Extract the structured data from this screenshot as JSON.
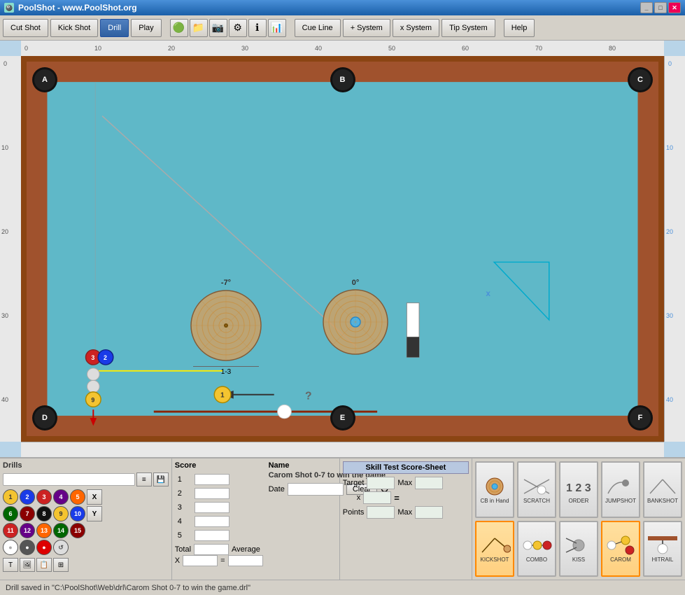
{
  "titlebar": {
    "title": "PoolShot - www.PoolShot.org",
    "icon": "🎱",
    "controls": [
      "_",
      "□",
      "✕"
    ]
  },
  "toolbar": {
    "cut_shot": "Cut Shot",
    "kick_shot": "Kick Shot",
    "drill": "Drill",
    "play": "Play",
    "cue_line": "Cue Line",
    "plus_system": "+ System",
    "x_system": "x System",
    "tip_system": "Tip System",
    "help": "Help"
  },
  "table": {
    "pockets": [
      "A",
      "B",
      "C",
      "D",
      "E",
      "F"
    ],
    "ruler_top": [
      "0",
      "10",
      "20",
      "30",
      "40",
      "50",
      "60",
      "70",
      "80"
    ],
    "ruler_side": [
      "0",
      "10",
      "20",
      "30",
      "40"
    ]
  },
  "drills": {
    "label": "Drills",
    "current_drill": "Carom Shot 0-7 to win the game",
    "balls": [
      {
        "num": "1",
        "color": "#f4c430",
        "stripe": false
      },
      {
        "num": "2",
        "color": "#1a3be8",
        "stripe": false
      },
      {
        "num": "3",
        "color": "#cc2222",
        "stripe": false
      },
      {
        "num": "4",
        "color": "#660088",
        "stripe": false
      },
      {
        "num": "5",
        "color": "#ff6600",
        "stripe": false
      },
      {
        "num": "6",
        "color": "#006600",
        "stripe": false
      },
      {
        "num": "7",
        "color": "#8B0000",
        "stripe": false
      },
      {
        "num": "8",
        "color": "#111111",
        "stripe": false
      },
      {
        "num": "9",
        "color": "#f4c430",
        "stripe": true
      },
      {
        "num": "10",
        "color": "#1a3be8",
        "stripe": true
      },
      {
        "num": "11",
        "color": "#cc2222",
        "stripe": true
      },
      {
        "num": "12",
        "color": "#660088",
        "stripe": true
      },
      {
        "num": "13",
        "color": "#ff6600",
        "stripe": true
      },
      {
        "num": "14",
        "color": "#006600",
        "stripe": true
      },
      {
        "num": "15",
        "color": "#8B0000",
        "stripe": true
      },
      {
        "num": "⚪",
        "color": "white",
        "stripe": false
      },
      {
        "num": "⚫",
        "color": "#777",
        "stripe": false
      },
      {
        "num": "🔴",
        "color": "#dd0000",
        "stripe": false
      },
      {
        "num": "↺",
        "color": "#aaa",
        "stripe": false
      }
    ]
  },
  "score": {
    "label": "Score",
    "name_label": "Name",
    "drill_name": "Carom Shot 0-7 to win the game",
    "date_label": "Date",
    "total_label": "Total",
    "average_label": "Average",
    "x_label": "X",
    "clear_btn": "Clear",
    "rows": [
      {
        "num": "1"
      },
      {
        "num": "2"
      },
      {
        "num": "3"
      },
      {
        "num": "4"
      },
      {
        "num": "5"
      }
    ]
  },
  "skill_test": {
    "title": "Skill Test Score-Sheet",
    "target_label": "Target",
    "max_label": "Max",
    "x_label": "x",
    "equals_label": "=",
    "points_label": "Points",
    "max2_label": "Max"
  },
  "shot_types": [
    {
      "label": "CB in Hand",
      "active": false,
      "key": "cb-in-hand"
    },
    {
      "label": "SCRATCH",
      "active": false,
      "key": "scratch"
    },
    {
      "label": "ORDER",
      "active": false,
      "key": "order"
    },
    {
      "label": "JUMPSHOT",
      "active": false,
      "key": "jumpshot"
    },
    {
      "label": "BANKSHOT",
      "active": false,
      "key": "bankshot"
    },
    {
      "label": "KICKSHOT",
      "active": true,
      "key": "kickshot"
    },
    {
      "label": "COMBO",
      "active": false,
      "key": "combo"
    },
    {
      "label": "KISS",
      "active": false,
      "key": "kiss"
    },
    {
      "label": "CAROM",
      "active": true,
      "key": "carom"
    },
    {
      "label": "HITRAIL",
      "active": false,
      "key": "hitrail"
    }
  ],
  "status": {
    "text": "Drill saved in \"C:\\PoolShot\\Web\\drl\\Carom Shot 0-7 to win the game.drl\""
  },
  "diagram_left": {
    "angle": "-7°",
    "label": "1-3"
  },
  "diagram_right": {
    "angle": "0°"
  }
}
